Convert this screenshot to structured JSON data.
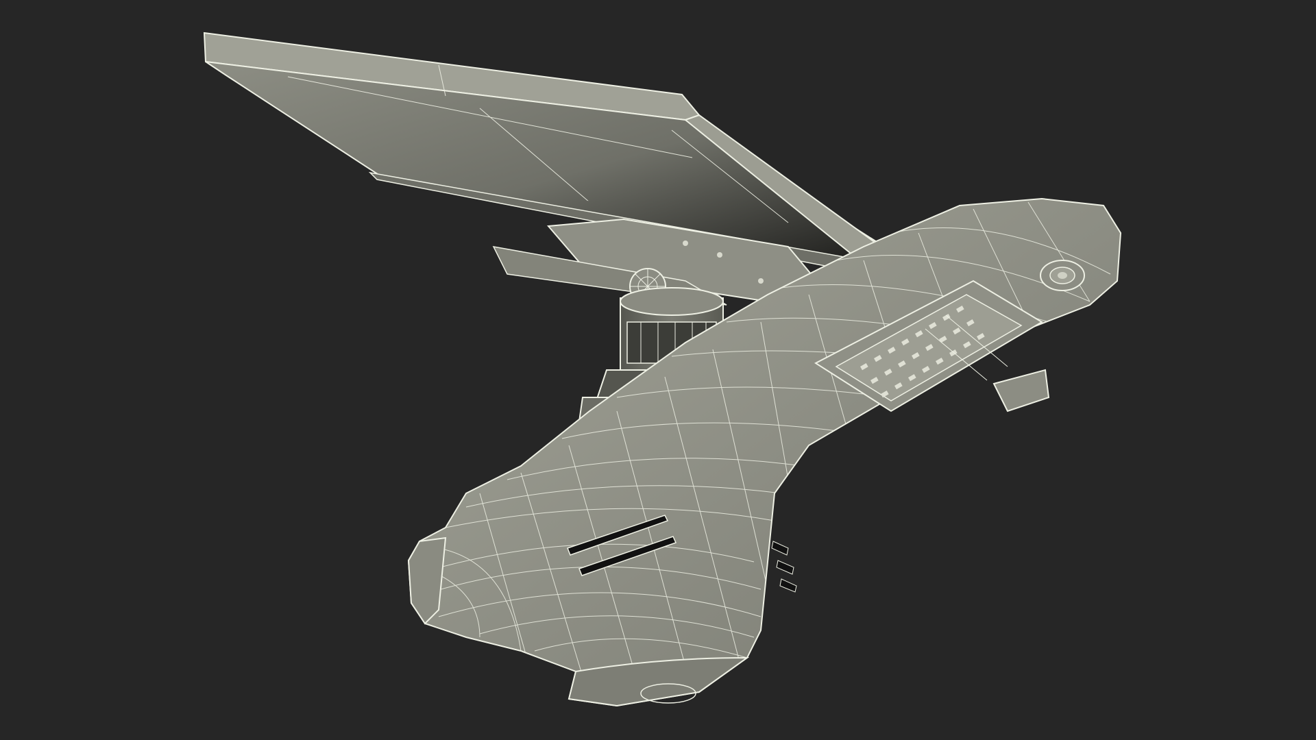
{
  "scene": {
    "background_color": "#262626",
    "subject": "solar-street-light-wireframe-icon",
    "colors": {
      "surface": "#8a8a80",
      "surface_light": "#a3a398",
      "surface_dark": "#5e5f57",
      "panel_shadow": "#1c1c1a",
      "wire": "#eef0e4",
      "slot": "#111111"
    }
  }
}
